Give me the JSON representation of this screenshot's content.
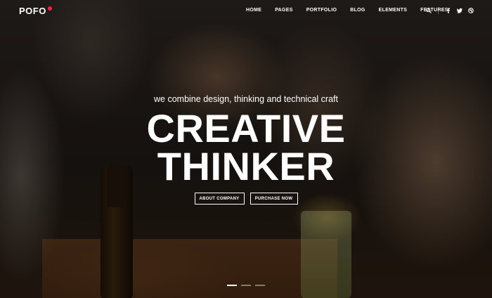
{
  "header": {
    "logo": "POFO",
    "nav": [
      "HOME",
      "PAGES",
      "PORTFOLIO",
      "BLOG",
      "ELEMENTS",
      "FEATURES"
    ],
    "icons": [
      "search-icon",
      "facebook-icon",
      "twitter-icon",
      "dribbble-icon"
    ]
  },
  "hero": {
    "tagline": "we combine design, thinking and technical craft",
    "headline_line1": "CREATIVE",
    "headline_line2": "THINKER",
    "button_about": "ABOUT COMPANY",
    "button_purchase": "PURCHASE NOW"
  },
  "slider": {
    "slides": 3,
    "active_index": 0
  },
  "colors": {
    "accent": "#ff214f",
    "text": "#ffffff"
  }
}
